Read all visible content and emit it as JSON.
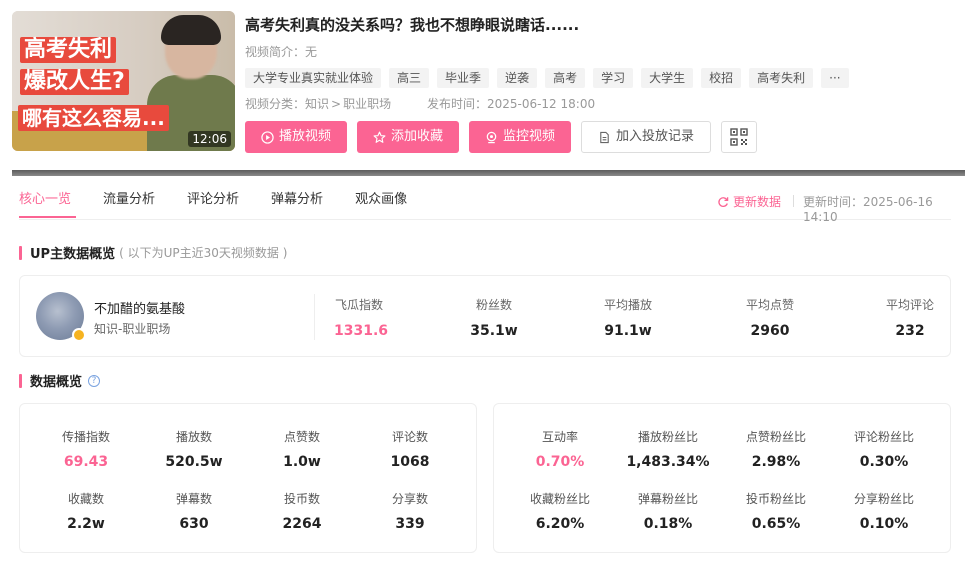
{
  "video": {
    "thumbnail_text_1": "高考失利",
    "thumbnail_text_2": "爆改人生?",
    "thumbnail_text_3": "哪有这么容易...",
    "duration": "12:06",
    "title": "高考失利真的没关系吗？我也不想睁眼说瞎话......",
    "desc_label": "视频简介：",
    "desc_value": "无",
    "tags": [
      "大学专业真实就业体验",
      "高三",
      "毕业季",
      "逆袭",
      "高考",
      "学习",
      "大学生",
      "校招",
      "高考失利",
      "···"
    ],
    "category_label": "视频分类：",
    "category_main": "知识",
    "category_sep": ">",
    "category_sub": "职业职场",
    "publish_label": "发布时间：",
    "publish_time": "2025-06-12 18:00"
  },
  "actions": {
    "play": "播放视频",
    "favorite": "添加收藏",
    "monitor": "监控视频",
    "add_record": "加入投放记录"
  },
  "tabs": [
    "核心一览",
    "流量分析",
    "评论分析",
    "弹幕分析",
    "观众画像"
  ],
  "refresh_label": "更新数据",
  "update_time": "更新时间：2025-06-16 14:10",
  "up_section": {
    "title": "UP主数据概览",
    "subtitle": "( 以下为UP主近30天视频数据 )",
    "name": "不加醋的氨基酸",
    "category": "知识-职业职场",
    "stats": [
      {
        "label": "飞瓜指数",
        "value": "1331.6"
      },
      {
        "label": "粉丝数",
        "value": "35.1w"
      },
      {
        "label": "平均播放",
        "value": "91.1w"
      },
      {
        "label": "平均点赞",
        "value": "2960"
      },
      {
        "label": "平均评论",
        "value": "232"
      }
    ]
  },
  "data_section": {
    "title": "数据概览",
    "help": "?",
    "left": [
      {
        "label": "传播指数",
        "value": "69.43"
      },
      {
        "label": "播放数",
        "value": "520.5w"
      },
      {
        "label": "点赞数",
        "value": "1.0w"
      },
      {
        "label": "评论数",
        "value": "1068"
      },
      {
        "label": "收藏数",
        "value": "2.2w"
      },
      {
        "label": "弹幕数",
        "value": "630"
      },
      {
        "label": "投币数",
        "value": "2264"
      },
      {
        "label": "分享数",
        "value": "339"
      }
    ],
    "right": [
      {
        "label": "互动率",
        "value": "0.70%"
      },
      {
        "label": "播放粉丝比",
        "value": "1,483.34%"
      },
      {
        "label": "点赞粉丝比",
        "value": "2.98%"
      },
      {
        "label": "评论粉丝比",
        "value": "0.30%"
      },
      {
        "label": "收藏粉丝比",
        "value": "6.20%"
      },
      {
        "label": "弹幕粉丝比",
        "value": "0.18%"
      },
      {
        "label": "投币粉丝比",
        "value": "0.65%"
      },
      {
        "label": "分享粉丝比",
        "value": "0.10%"
      }
    ]
  },
  "colors": {
    "accent": "#fb6493",
    "text": "#222222",
    "muted": "#999999"
  }
}
